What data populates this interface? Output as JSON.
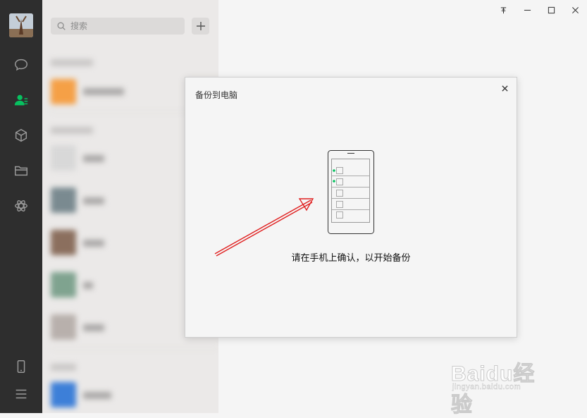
{
  "search": {
    "placeholder": "搜索"
  },
  "dialog": {
    "title": "备份到电脑",
    "message": "请在手机上确认，以开始备份"
  },
  "window_controls": [
    "pin",
    "minimize",
    "maximize",
    "close"
  ],
  "sidebar": {
    "icons": [
      "chat-icon",
      "contacts-icon",
      "favorites-icon",
      "folder-icon",
      "miniprogram-icon",
      "phone-icon",
      "menu-icon"
    ],
    "active": "contacts-icon"
  },
  "watermark": {
    "logo": "Baidu经验",
    "url": "jingyan.baidu.com"
  },
  "colors": {
    "sidebar": "#2e2e2e",
    "accent": "#07c160",
    "arrow": "#e02020"
  }
}
